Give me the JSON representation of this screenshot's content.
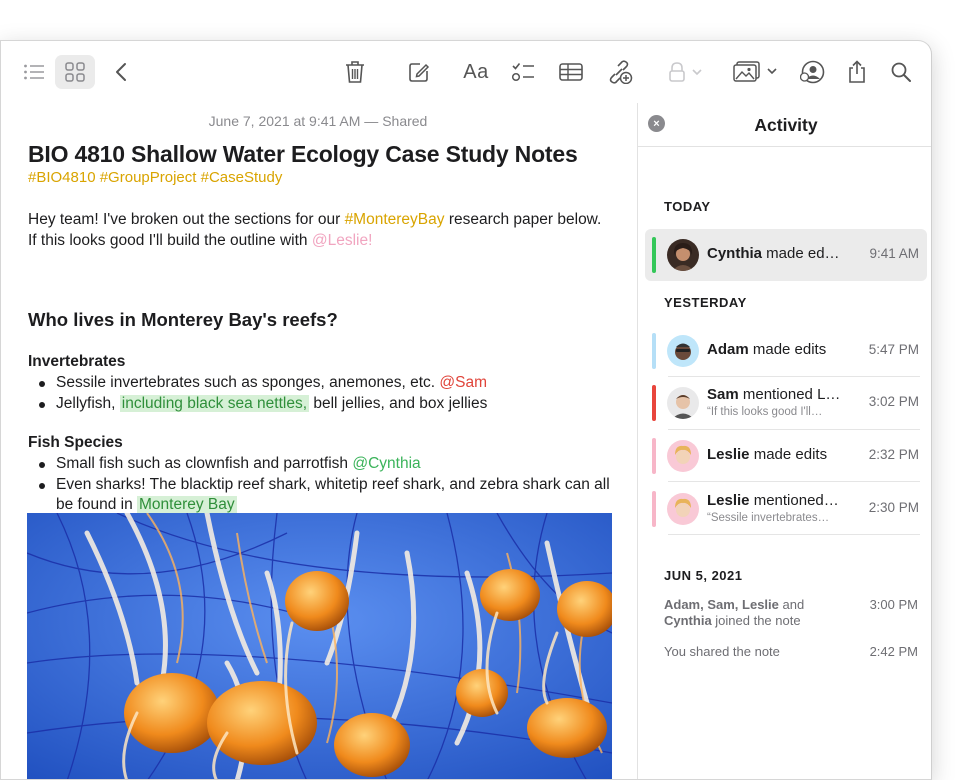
{
  "toolbar": {
    "font_button": "Aa"
  },
  "note": {
    "meta": "June 7, 2021 at 9:41 AM — Shared",
    "title": "BIO 4810 Shallow Water Ecology Case Study Notes",
    "tags": "#BIO4810 #GroupProject #CaseStudy",
    "intro_1": "Hey team! I've broken out the sections for our ",
    "intro_tag": "#MontereyBay",
    "intro_2": " research paper below. If this looks good I'll build the outline with ",
    "intro_mention": "@Leslie!",
    "heading": "Who lives in Monterey Bay's reefs?",
    "invert_heading": "Invertebrates",
    "invert_item1_text": "Sessile invertebrates such as sponges, anemones, etc. ",
    "invert_item1_mention": "@Sam",
    "invert_item2_a": "Jellyfish, ",
    "invert_item2_hl": "including black sea nettles,",
    "invert_item2_b": " bell jellies, and box jellies",
    "fish_heading": "Fish Species",
    "fish_item1_text": "Small fish such as clownfish and parrotfish ",
    "fish_item1_mention": "@Cynthia",
    "fish_item2_text": "Even sharks! The blacktip reef shark, whitetip reef shark, and zebra shark can all be found in ",
    "fish_item2_hl": "Monterey Bay"
  },
  "activity": {
    "title": "Activity",
    "close_symbol": "×",
    "today_label": "TODAY",
    "yesterday_label": "YESTERDAY",
    "older_label": "JUN 5, 2021",
    "items": [
      {
        "name": "Cynthia",
        "action": " made ed…",
        "time": "9:41 AM",
        "color": "#34c759"
      },
      {
        "name": "Adam",
        "action": " made edits",
        "time": "5:47 PM",
        "color": "#b5dff7"
      },
      {
        "name": "Sam",
        "action": " mentioned L…",
        "sub": "“If this looks good I'll…",
        "time": "3:02 PM",
        "color": "#e8453c"
      },
      {
        "name": "Leslie",
        "action": " made edits",
        "time": "2:32 PM",
        "color": "#f7b6c8"
      },
      {
        "name": "Leslie",
        "action": " mentioned…",
        "sub": "“Sessile invertebrates…",
        "time": "2:30 PM",
        "color": "#f7b6c8"
      }
    ],
    "older": [
      {
        "text_bold": "Adam, Sam, Leslie",
        "text_mid": " and ",
        "text_bold2": "Cynthia",
        "text_rest": " joined the note",
        "time": "3:00 PM"
      },
      {
        "text": "You shared the note",
        "time": "2:42 PM"
      }
    ]
  }
}
